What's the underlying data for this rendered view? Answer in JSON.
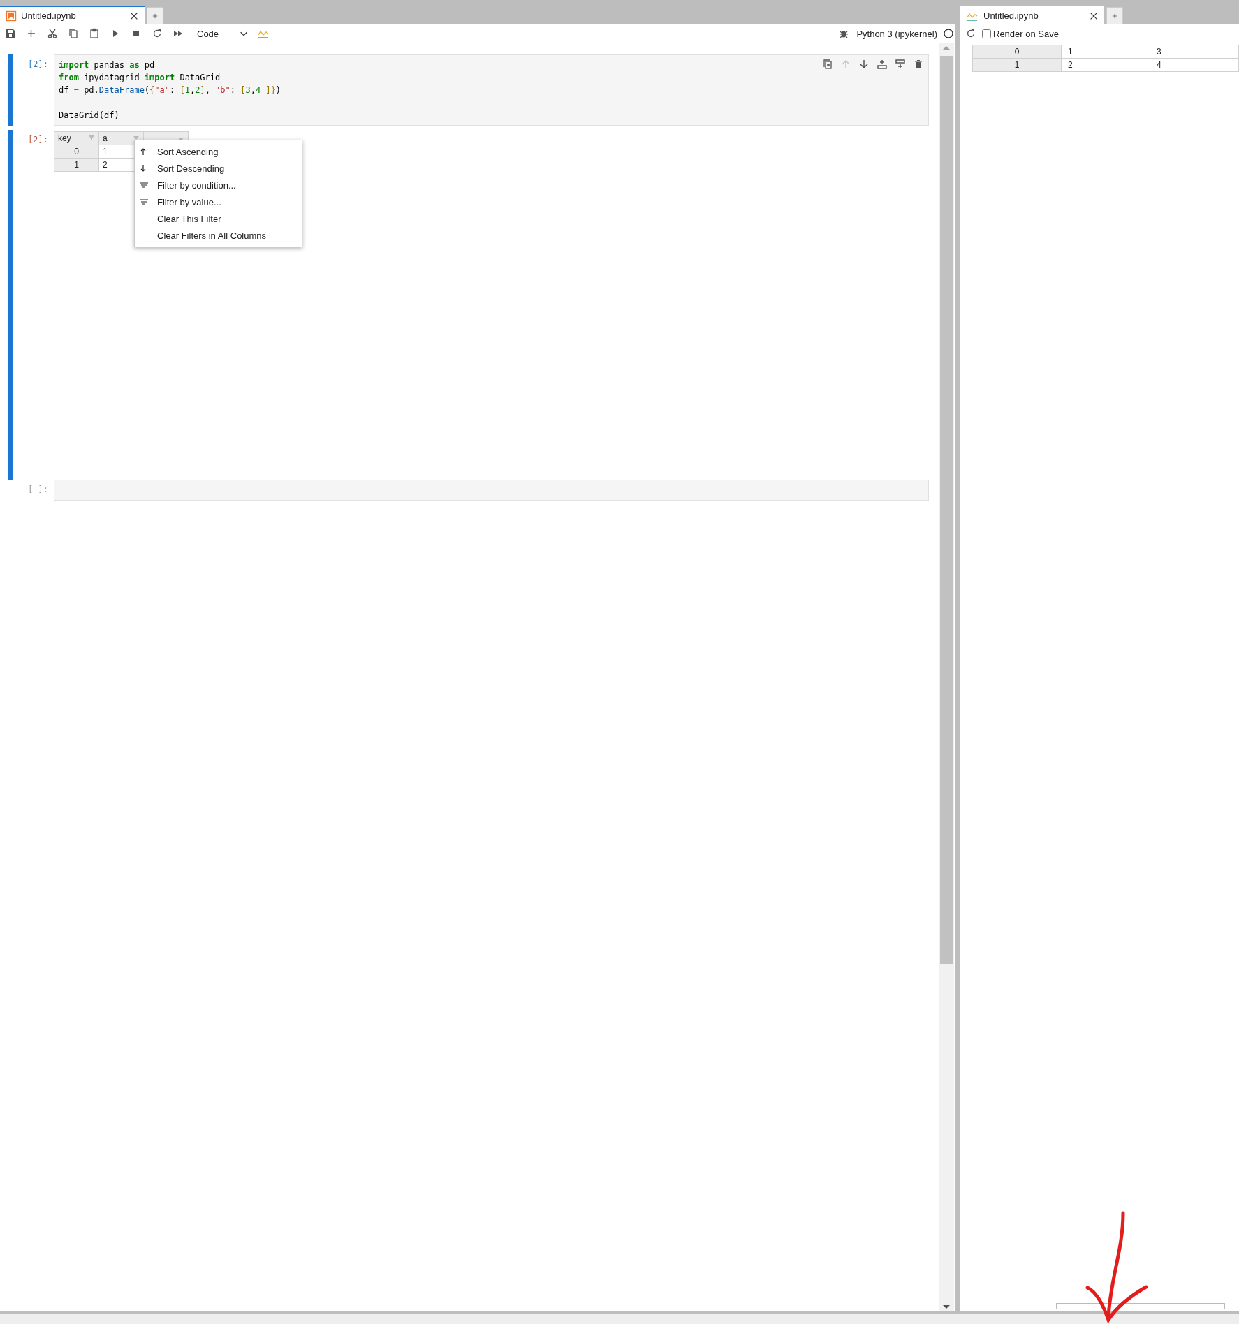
{
  "left_panel": {
    "tabs": [
      {
        "label": "Untitled.ipynb",
        "selected": true,
        "kind": "notebook"
      }
    ],
    "toolbar": {
      "cell_type": "Code",
      "kernel": "Python 3 (ipykernel)"
    },
    "cells": [
      {
        "selected": true,
        "input": {
          "prompt": "[2]:",
          "lines": [
            {
              "tokens": [
                {
                  "kind": "keyword",
                  "text": "import"
                },
                {
                  "kind": "plain",
                  "text": " pandas "
                },
                {
                  "kind": "keyword",
                  "text": "as"
                },
                {
                  "kind": "plain",
                  "text": " pd"
                }
              ]
            },
            {
              "tokens": [
                {
                  "kind": "keyword",
                  "text": "from"
                },
                {
                  "kind": "plain",
                  "text": " ipydatagrid "
                },
                {
                  "kind": "keyword",
                  "text": "import"
                },
                {
                  "kind": "plain",
                  "text": " DataGrid"
                }
              ]
            },
            {
              "tokens": [
                {
                  "kind": "plain",
                  "text": "df "
                },
                {
                  "kind": "operator",
                  "text": "="
                },
                {
                  "kind": "plain",
                  "text": " pd."
                },
                {
                  "kind": "attribute",
                  "text": "DataFrame"
                },
                {
                  "kind": "plain",
                  "text": "("
                },
                {
                  "kind": "bracket",
                  "text": "{"
                },
                {
                  "kind": "string",
                  "text": "\"a\""
                },
                {
                  "kind": "plain",
                  "text": ": "
                },
                {
                  "kind": "bracket",
                  "text": "["
                },
                {
                  "kind": "number",
                  "text": "1"
                },
                {
                  "kind": "plain",
                  "text": ","
                },
                {
                  "kind": "number",
                  "text": "2"
                },
                {
                  "kind": "bracket",
                  "text": "]"
                },
                {
                  "kind": "plain",
                  "text": ", "
                },
                {
                  "kind": "string",
                  "text": "\"b\""
                },
                {
                  "kind": "plain",
                  "text": ": "
                },
                {
                  "kind": "bracket",
                  "text": "["
                },
                {
                  "kind": "number",
                  "text": "3"
                },
                {
                  "kind": "plain",
                  "text": ","
                },
                {
                  "kind": "number",
                  "text": "4"
                },
                {
                  "kind": "bracket",
                  "text": " ]"
                },
                {
                  "kind": "bracket",
                  "text": "}"
                },
                {
                  "kind": "plain",
                  "text": ")"
                }
              ]
            },
            {
              "spacer_before": true,
              "tokens": [
                {
                  "kind": "plain",
                  "text": "DataGrid(df)"
                }
              ]
            }
          ],
          "cell_toolbar": [
            {
              "kind": "duplicate",
              "disabled": false
            },
            {
              "kind": "move-up",
              "disabled": true
            },
            {
              "kind": "move-down",
              "disabled": false
            },
            {
              "kind": "insert-above",
              "disabled": false
            },
            {
              "kind": "insert-below",
              "disabled": false
            },
            {
              "kind": "delete",
              "disabled": false
            }
          ]
        },
        "output": {
          "prompt": "[2]:",
          "grid": {
            "columns": [
              {
                "label": "key",
                "kind": "funnel"
              },
              {
                "label": "a",
                "kind": "caret"
              },
              {
                "kind": "caret"
              }
            ],
            "rows": [
              [
                "0",
                "1"
              ],
              [
                "1",
                "2"
              ]
            ]
          },
          "context_menu": [
            {
              "kind": "sort-ascending",
              "label": "Sort Ascending"
            },
            {
              "kind": "sort-descending",
              "label": "Sort Descending"
            },
            {
              "kind": "filter",
              "label": "Filter by condition..."
            },
            {
              "kind": "filter",
              "label": "Filter by value..."
            },
            {
              "kind": "plain",
              "label": "Clear This Filter"
            },
            {
              "kind": "plain",
              "label": "Clear Filters in All Columns"
            }
          ]
        }
      },
      {
        "selected": false,
        "input": {
          "prompt": "[ ]:"
        }
      }
    ]
  },
  "right_panel": {
    "tabs": [
      {
        "label": "Untitled.ipynb",
        "selected": false,
        "kind": "preview"
      }
    ],
    "render_on_save": {
      "label": "Render on Save",
      "checked": false
    },
    "table": {
      "rows": [
        [
          "0",
          "1",
          "3"
        ],
        [
          "1",
          "2",
          "4"
        ]
      ]
    }
  }
}
